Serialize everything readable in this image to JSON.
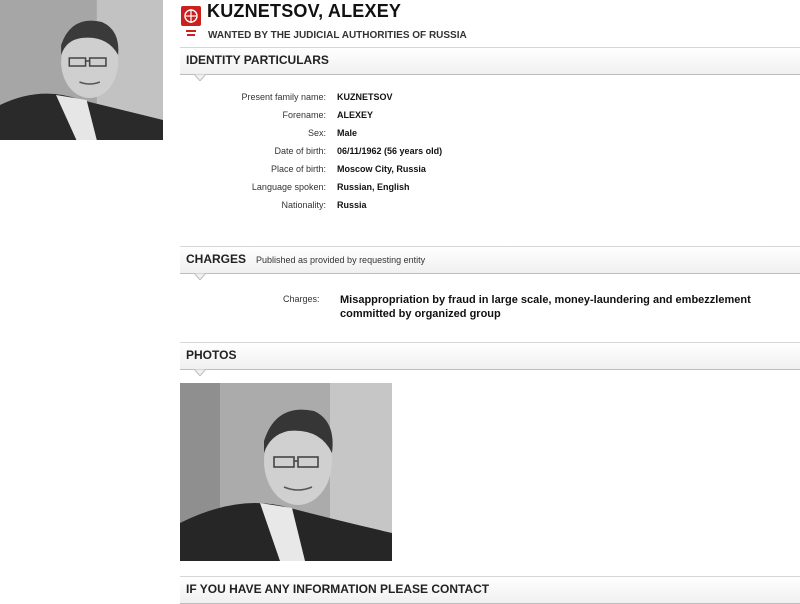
{
  "header": {
    "name": "KUZNETSOV, ALEXEY",
    "subtitle": "WANTED BY THE JUDICIAL AUTHORITIES OF RUSSIA",
    "logo_icon": "interpol-red-notice-logo",
    "logo_color": "#cc1f1f"
  },
  "identity": {
    "title": "IDENTITY PARTICULARS",
    "fields": [
      {
        "label": "Present family name:",
        "value": "KUZNETSOV"
      },
      {
        "label": "Forename:",
        "value": "ALEXEY"
      },
      {
        "label": "Sex:",
        "value": "Male"
      },
      {
        "label": "Date of birth:",
        "value": "06/11/1962 (56 years old)"
      },
      {
        "label": "Place of birth:",
        "value": "Moscow City, Russia"
      },
      {
        "label": "Language spoken:",
        "value": "Russian, English"
      },
      {
        "label": "Nationality:",
        "value": "Russia"
      }
    ]
  },
  "charges": {
    "title": "CHARGES",
    "note": "Published as provided by requesting entity",
    "label": "Charges:",
    "text": "Misappropriation by fraud in large scale, money-laundering and embezzlement committed by organized group"
  },
  "photos": {
    "title": "PHOTOS"
  },
  "contact": {
    "title": "IF YOU HAVE ANY INFORMATION PLEASE CONTACT"
  }
}
